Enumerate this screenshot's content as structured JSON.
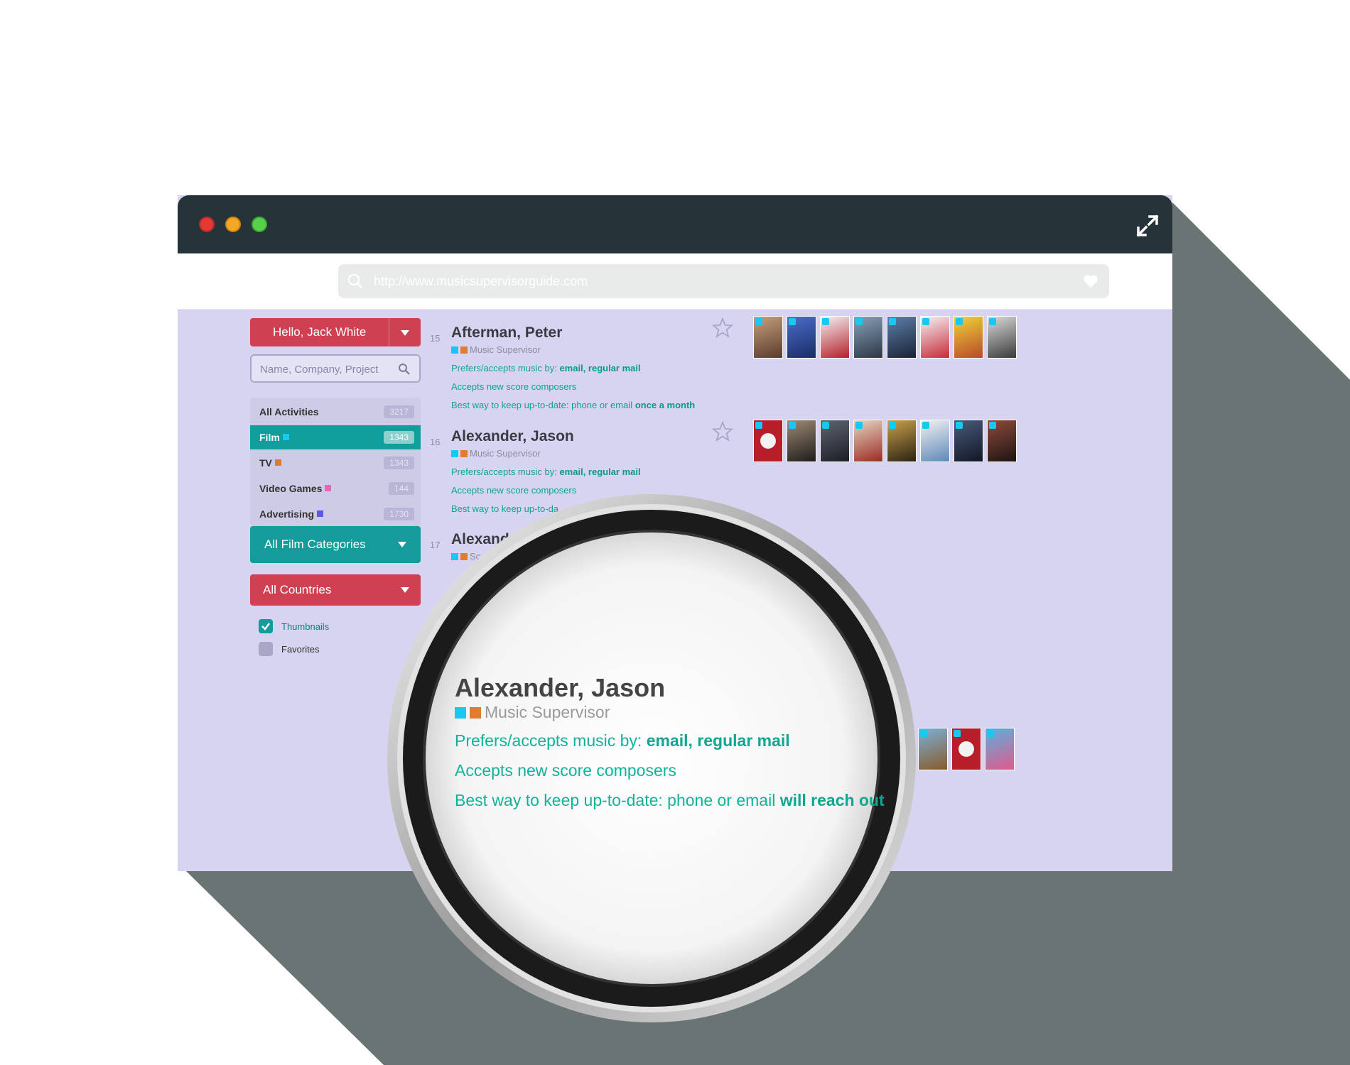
{
  "browser": {
    "url": "http://www.musicsupervisorguide.com"
  },
  "sidebar": {
    "user_button": "Hello, Jack White",
    "search_placeholder": "Name, Company, Project",
    "categories": [
      {
        "label": "All Activities",
        "count": "3217",
        "color": ""
      },
      {
        "label": "Film",
        "count": "1343",
        "color": "#18c8f0"
      },
      {
        "label": "TV",
        "count": "1343",
        "color": "#e07b30"
      },
      {
        "label": "Video Games",
        "count": "144",
        "color": "#e06ab8"
      },
      {
        "label": "Advertising",
        "count": "1730",
        "color": "#5a5adb"
      }
    ],
    "film_categories": "All Film Categories",
    "countries": "All Countries",
    "thumbnails_label": "Thumbnails",
    "thumbnails_checked": true,
    "favorites_label": "Favorites",
    "favorites_checked": false
  },
  "entries": [
    {
      "num": "15",
      "name": "Afterman, Peter",
      "role": "Music Supervisor",
      "prefers_prefix": "Prefers/accepts music by: ",
      "prefers_value": "email, regular mail",
      "accepts": "Accepts new score composers",
      "best_prefix": "Best way to keep up-to-date: phone or email ",
      "best_value": "once a month"
    },
    {
      "num": "16",
      "name": "Alexander, Jason",
      "role": "Music Supervisor",
      "prefers_prefix": "Prefers/accepts music by: ",
      "prefers_value": "email, regular mail",
      "accepts": "Accepts new score composers",
      "best_partial": "Best way to keep up-to-da"
    },
    {
      "num": "17",
      "name_partial": "Alexand",
      "role_partial": "Sc"
    }
  ],
  "magnifier": {
    "name": "Alexander, Jason",
    "role": "Music Supervisor",
    "prefers_prefix": "Prefers/accepts music by: ",
    "prefers_value": "email, regular mail",
    "accepts": "Accepts new score composers",
    "best_prefix": "Best way to keep up-to-date: phone or email ",
    "best_value": "will reach out"
  },
  "colors": {
    "red_accent": "#cf4152",
    "teal_accent": "#139c9a",
    "content_bg": "#d6d4f0",
    "titlebar": "#263439",
    "link_green": "#10a38e"
  },
  "icons": {
    "url_search": "search-icon",
    "url_favorite": "heart-icon",
    "window_expand": "expand-icon",
    "favorite_toggle": "star-icon",
    "poster_placeholder": "film-reel-icon"
  }
}
